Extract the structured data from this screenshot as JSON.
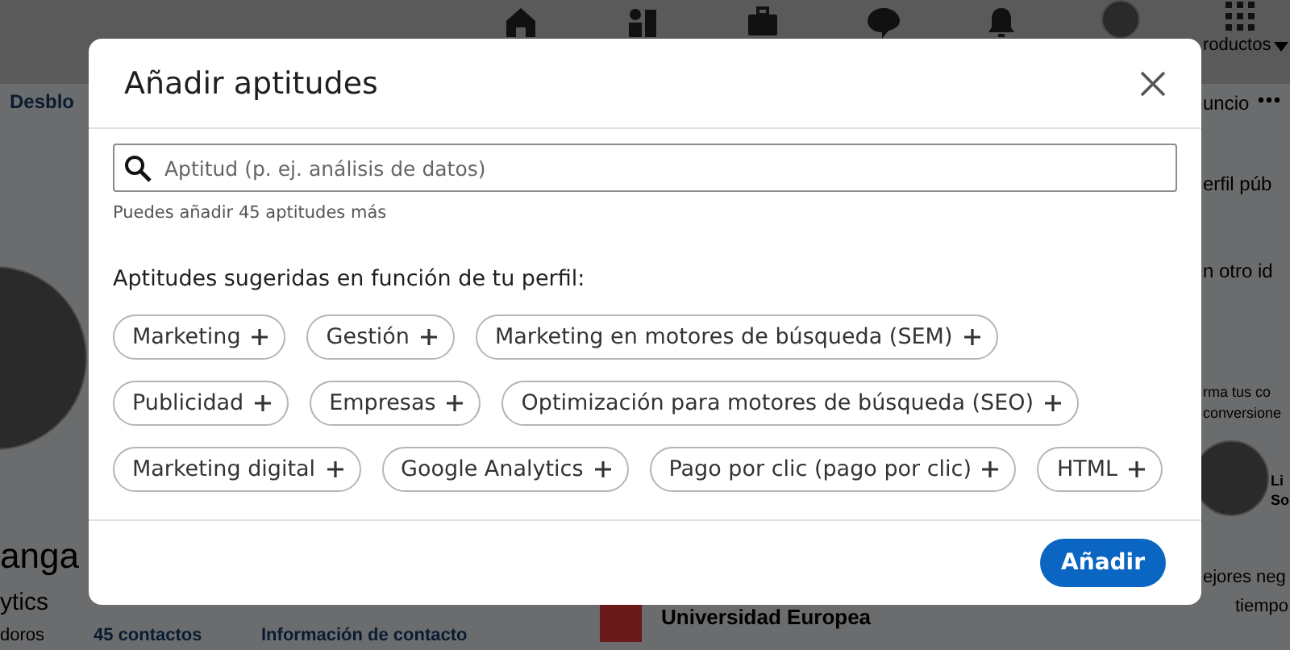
{
  "background": {
    "nav_menu": "roductos",
    "left_link": "Desblo",
    "right_texts": [
      {
        "kind": "menu",
        "text": "uncio"
      },
      {
        "kind": "link",
        "text": "erfil púb"
      },
      {
        "kind": "link",
        "text": "n otro id"
      },
      {
        "kind": "small",
        "text": "rma tus co"
      },
      {
        "kind": "small",
        "text": "conversione"
      },
      {
        "kind": "tiny",
        "text": "Li"
      },
      {
        "kind": "tiny",
        "text": "So"
      },
      {
        "kind": "large",
        "text": "ejores neg"
      },
      {
        "kind": "large",
        "text": "tiempo"
      }
    ],
    "profile_name": "anga",
    "profile_headline": "ytics",
    "profile_links": [
      "doros",
      "45 contactos",
      "Información de contacto"
    ],
    "education": "Universidad Europea"
  },
  "dialog": {
    "title": "Añadir aptitudes",
    "search": {
      "placeholder": "Aptitud (p. ej. análisis de datos)"
    },
    "hint": "Puedes añadir 45 aptitudes más",
    "suggestions_title": "Aptitudes sugeridas en función de tu perfil:",
    "suggestion_rows": [
      [
        "Marketing",
        "Gestión",
        "Marketing en motores de búsqueda (SEM)"
      ],
      [
        "Publicidad",
        "Empresas",
        "Optimización para motores de búsqueda (SEO)"
      ],
      [
        "Marketing digital",
        "Google Analytics",
        "Pago por clic (pago por clic)",
        "HTML"
      ]
    ],
    "submit": "Añadir"
  }
}
